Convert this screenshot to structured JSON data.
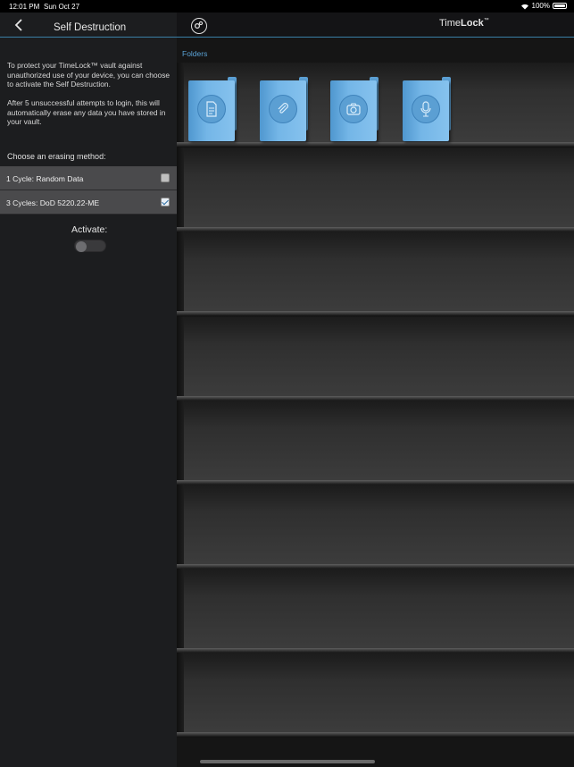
{
  "status": {
    "time": "12:01 PM",
    "date": "Sun Oct 27",
    "battery": "100%"
  },
  "left": {
    "title": "Self Destruction",
    "desc1": "To protect your TimeLock™ vault against unauthorized use of your device, you can choose to activate the Self Destruction.",
    "desc2": "After 5 unsuccessful attempts to login, this will automatically erase any data you have stored in your vault.",
    "choose_label": "Choose an erasing method:",
    "options": [
      {
        "label": "1 Cycle: Random Data",
        "checked": false
      },
      {
        "label": "3 Cycles: DoD 5220.22-ME",
        "checked": true
      }
    ],
    "activate_label": "Activate:",
    "activate_on": false
  },
  "right": {
    "app_title_part1": "Time",
    "app_title_part2": "Lock",
    "app_title_tm": "™",
    "folders_label": "Folders",
    "folders": [
      {
        "icon": "document-icon"
      },
      {
        "icon": "paperclip-icon"
      },
      {
        "icon": "camera-icon"
      },
      {
        "icon": "microphone-icon"
      }
    ]
  },
  "colors": {
    "accent": "#3a7fa6",
    "folder": "#74b6e7",
    "link": "#5aa3d6"
  }
}
